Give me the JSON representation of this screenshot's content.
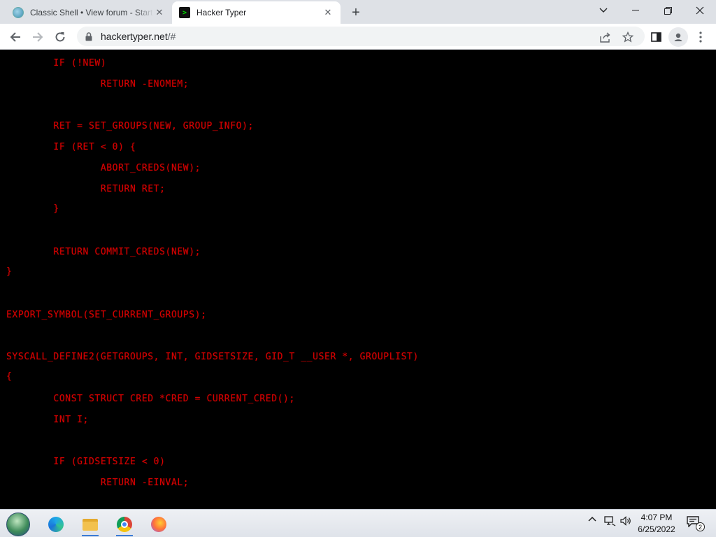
{
  "browser": {
    "tabs": [
      {
        "title": "Classic Shell • View forum - Start",
        "active": false,
        "favicon": "globe-icon"
      },
      {
        "title": "Hacker Typer",
        "active": true,
        "favicon": "terminal-icon"
      }
    ],
    "favicon_text": ">",
    "new_tab": "+",
    "url_host": "hackertyper.net",
    "url_path": "/#"
  },
  "terminal": {
    "text_color": "#d40000",
    "background": "#000000",
    "lines": [
      {
        "text": "        IF (!NEW)"
      },
      {
        "text": "                RETURN -ENOMEM;"
      },
      {
        "text": ""
      },
      {
        "text": "        RET = SET_GROUPS(NEW, GROUP_INFO);"
      },
      {
        "text": "        IF (RET < 0) {"
      },
      {
        "text": "                ABORT_CREDS(NEW);"
      },
      {
        "text": "                RETURN RET;"
      },
      {
        "text": "        }"
      },
      {
        "text": ""
      },
      {
        "text": "        RETURN COMMIT_CREDS(NEW);"
      },
      {
        "text": "}"
      },
      {
        "text": ""
      },
      {
        "text": "EXPORT_SYMBOL(SET_CURRENT_GROUPS);"
      },
      {
        "text": ""
      },
      {
        "text": "SYSCALL_DEFINE2(GETGROUPS, INT, GIDSETSIZE, GID_T __USER *, GROUPLIST)"
      },
      {
        "text": "{"
      },
      {
        "text": "        CONST STRUCT CRED *CRED = CURRENT_CRED();"
      },
      {
        "text": "        INT I;"
      },
      {
        "text": ""
      },
      {
        "text": "        IF (GIDSETSIZE < 0)"
      },
      {
        "text": "                RETURN -EINVAL;"
      }
    ]
  },
  "taskbar": {
    "apps": [
      "start-orb-icon",
      "edge-icon",
      "file-explorer-icon",
      "chrome-icon",
      "firefox-icon"
    ],
    "time": "4:07 PM",
    "date": "6/25/2022",
    "notification_count": "2"
  }
}
